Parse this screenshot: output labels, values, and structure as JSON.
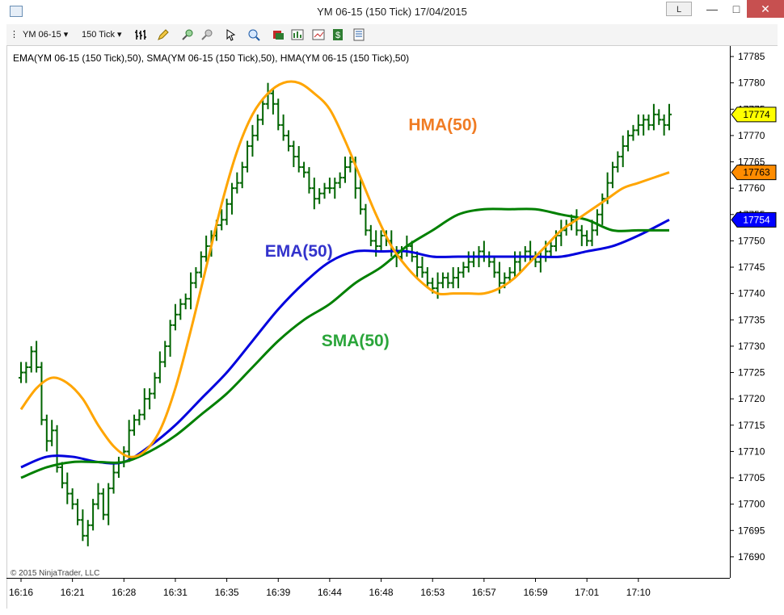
{
  "window": {
    "title": "YM 06-15 (150 Tick)  17/04/2015",
    "link_button": "L",
    "minimize": "—",
    "maximize": "□",
    "close": "✕"
  },
  "toolbar": {
    "instrument": "YM 06-15",
    "interval": "150 Tick",
    "icons": [
      "bar-type-icon",
      "drawing-pencil-icon",
      "zoom-in-icon",
      "zoom-out-icon",
      "cursor-icon",
      "zoom-icon",
      "indicators-icon",
      "strategies-icon",
      "chart-properties-icon",
      "money-icon",
      "data-box-icon"
    ]
  },
  "copyright": "© 2015 NinjaTrader, LLC",
  "colors": {
    "price_bars": "#006400",
    "ema": "#0000dd",
    "sma": "#008000",
    "hma": "#ffa500",
    "ema_label": "#3333cc",
    "sma_label": "#2aa53a",
    "hma_label": "#f07c24",
    "last_price_marker": "#ffff00",
    "hma_marker": "#ff8c00",
    "ema_marker": "#0000ff"
  },
  "chart_data": {
    "type": "line",
    "subtitle": "EMA(YM 06-15 (150 Tick),50), SMA(YM 06-15 (150 Tick),50), HMA(YM 06-15 (150 Tick),50)",
    "ylim": [
      17686,
      17787
    ],
    "y_ticks": [
      17690,
      17695,
      17700,
      17705,
      17710,
      17715,
      17720,
      17725,
      17730,
      17735,
      17740,
      17745,
      17750,
      17755,
      17760,
      17765,
      17770,
      17775,
      17780,
      17785
    ],
    "x_ticks": [
      {
        "i": 0,
        "label": "16:16"
      },
      {
        "i": 10,
        "label": "16:21"
      },
      {
        "i": 20,
        "label": "16:28"
      },
      {
        "i": 30,
        "label": "16:31"
      },
      {
        "i": 40,
        "label": "16:35"
      },
      {
        "i": 50,
        "label": "16:39"
      },
      {
        "i": 60,
        "label": "16:44"
      },
      {
        "i": 70,
        "label": "16:48"
      },
      {
        "i": 80,
        "label": "16:53"
      },
      {
        "i": 90,
        "label": "16:57"
      },
      {
        "i": 100,
        "label": "16:59"
      },
      {
        "i": 110,
        "label": "17:01"
      },
      {
        "i": 120,
        "label": "17:10"
      }
    ],
    "bar_count": 127,
    "close": [
      17725,
      17726,
      17729,
      17726,
      17716,
      17712,
      17714,
      17707,
      17704,
      17702,
      17700,
      17697,
      17694,
      17696,
      17700,
      17702,
      17698,
      17703,
      17706,
      17708,
      17710,
      17714,
      17716,
      17717,
      17720,
      17721,
      17724,
      17727,
      17730,
      17734,
      17736,
      17738,
      17739,
      17742,
      17744,
      17747,
      17749,
      17751,
      17753,
      17754,
      17757,
      17760,
      17761,
      17764,
      17768,
      17770,
      17773,
      17776,
      17778,
      17776,
      17772,
      17770,
      17768,
      17766,
      17764,
      17763,
      17760,
      17758,
      17759,
      17760,
      17760,
      17761,
      17762,
      17764,
      17765,
      17760,
      17756,
      17752,
      17750,
      17749,
      17751,
      17750,
      17748,
      17747,
      17748,
      17749,
      17747,
      17745,
      17744,
      17742,
      17741,
      17742,
      17743,
      17742,
      17743,
      17744,
      17745,
      17746,
      17747,
      17748,
      17747,
      17746,
      17744,
      17742,
      17743,
      17744,
      17746,
      17747,
      17748,
      17747,
      17746,
      17747,
      17748,
      17749,
      17751,
      17752,
      17753,
      17754,
      17752,
      17751,
      17750,
      17752,
      17755,
      17758,
      17761,
      17764,
      17766,
      17768,
      17770,
      17771,
      17772,
      17773,
      17772,
      17774,
      17773,
      17772,
      17774
    ],
    "series": [
      {
        "name": "EMA(50)",
        "color": "#0000dd",
        "points": [
          [
            0,
            17707
          ],
          [
            5,
            17709
          ],
          [
            10,
            17709
          ],
          [
            15,
            17708
          ],
          [
            20,
            17708
          ],
          [
            25,
            17711
          ],
          [
            30,
            17715
          ],
          [
            35,
            17720
          ],
          [
            40,
            17725
          ],
          [
            45,
            17731
          ],
          [
            50,
            17737
          ],
          [
            55,
            17742
          ],
          [
            60,
            17746
          ],
          [
            65,
            17748
          ],
          [
            70,
            17748
          ],
          [
            75,
            17748
          ],
          [
            80,
            17747
          ],
          [
            85,
            17747
          ],
          [
            90,
            17747
          ],
          [
            95,
            17747
          ],
          [
            100,
            17747
          ],
          [
            105,
            17747
          ],
          [
            110,
            17748
          ],
          [
            115,
            17749
          ],
          [
            120,
            17751
          ],
          [
            126,
            17754
          ]
        ]
      },
      {
        "name": "SMA(50)",
        "color": "#008000",
        "points": [
          [
            0,
            17705
          ],
          [
            5,
            17707
          ],
          [
            10,
            17708
          ],
          [
            15,
            17708
          ],
          [
            20,
            17708
          ],
          [
            25,
            17710
          ],
          [
            30,
            17713
          ],
          [
            35,
            17717
          ],
          [
            40,
            17721
          ],
          [
            45,
            17726
          ],
          [
            50,
            17731
          ],
          [
            55,
            17735
          ],
          [
            60,
            17738
          ],
          [
            65,
            17742
          ],
          [
            70,
            17745
          ],
          [
            75,
            17749
          ],
          [
            80,
            17752
          ],
          [
            85,
            17755
          ],
          [
            90,
            17756
          ],
          [
            95,
            17756
          ],
          [
            100,
            17756
          ],
          [
            105,
            17755
          ],
          [
            110,
            17754
          ],
          [
            115,
            17752
          ],
          [
            120,
            17752
          ],
          [
            126,
            17752
          ]
        ]
      },
      {
        "name": "HMA(50)",
        "color": "#ffa500",
        "points": [
          [
            0,
            17718
          ],
          [
            3,
            17722
          ],
          [
            6,
            17724
          ],
          [
            9,
            17723
          ],
          [
            12,
            17720
          ],
          [
            15,
            17715
          ],
          [
            18,
            17711
          ],
          [
            21,
            17709
          ],
          [
            24,
            17710
          ],
          [
            27,
            17714
          ],
          [
            30,
            17722
          ],
          [
            33,
            17733
          ],
          [
            36,
            17745
          ],
          [
            39,
            17757
          ],
          [
            42,
            17767
          ],
          [
            45,
            17774
          ],
          [
            48,
            17778
          ],
          [
            51,
            17780
          ],
          [
            54,
            17780
          ],
          [
            57,
            17778
          ],
          [
            60,
            17775
          ],
          [
            63,
            17769
          ],
          [
            66,
            17762
          ],
          [
            69,
            17755
          ],
          [
            72,
            17749
          ],
          [
            75,
            17745
          ],
          [
            78,
            17742
          ],
          [
            81,
            17740
          ],
          [
            84,
            17740
          ],
          [
            87,
            17740
          ],
          [
            90,
            17740
          ],
          [
            93,
            17741
          ],
          [
            96,
            17743
          ],
          [
            99,
            17746
          ],
          [
            102,
            17749
          ],
          [
            105,
            17752
          ],
          [
            108,
            17754
          ],
          [
            111,
            17756
          ],
          [
            114,
            17758
          ],
          [
            117,
            17760
          ],
          [
            120,
            17761
          ],
          [
            123,
            17762
          ],
          [
            126,
            17763
          ]
        ]
      }
    ],
    "annotations": [
      {
        "text": "HMA(50)",
        "series": "HMA(50)",
        "at_i": 82,
        "at_y": 17771
      },
      {
        "text": "EMA(50)",
        "series": "EMA(50)",
        "at_i": 54,
        "at_y": 17747
      },
      {
        "text": "SMA(50)",
        "series": "SMA(50)",
        "at_i": 65,
        "at_y": 17730
      }
    ],
    "price_markers": [
      {
        "value": 17774,
        "label": "17774",
        "color": "#ffff00",
        "text_color": "#000000"
      },
      {
        "value": 17763,
        "label": "17763",
        "color": "#ff8c00",
        "text_color": "#000000"
      },
      {
        "value": 17754,
        "label": "17754",
        "color": "#0000ff",
        "text_color": "#ffffff"
      }
    ]
  }
}
